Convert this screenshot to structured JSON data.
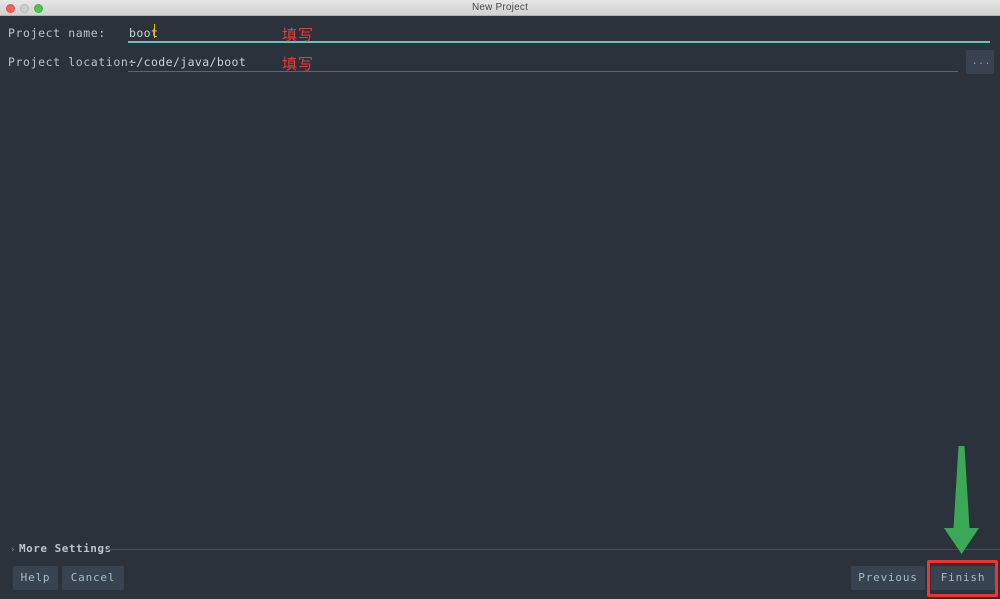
{
  "window": {
    "title": "New Project",
    "controls": {
      "close": "close-button",
      "minimize": "minimize-button",
      "maximize": "maximize-button"
    }
  },
  "form": {
    "fields": [
      {
        "label": "Project name:",
        "value": "boot",
        "focused": true,
        "underline_color": "#69c2b8"
      },
      {
        "label": "Project location:",
        "value": "~/code/java/boot",
        "focused": false,
        "underline_color": "#5b6570"
      }
    ],
    "browse_button_label": "..."
  },
  "more_settings": {
    "label": "More Settings",
    "chevron": "›",
    "expanded": false
  },
  "footer": {
    "help_label": "Help",
    "cancel_label": "Cancel",
    "previous_label": "Previous",
    "finish_label": "Finish"
  },
  "annotations": {
    "name_note": "填写",
    "location_note": "填写",
    "note_color": "#e83b3b",
    "highlight_box_color": "#f4322e",
    "arrow_color": "#3aa856",
    "arrow_direction": "down",
    "arrow_target": "Finish"
  },
  "theme": {
    "background": "#2b323b",
    "label_text": "#b9c3cb",
    "value_text": "#c9d2d9",
    "button_background": "#374350",
    "button_text": "#aebac5",
    "titlebar_text": "#4a4a4a",
    "caret_color": "#e5c100"
  }
}
